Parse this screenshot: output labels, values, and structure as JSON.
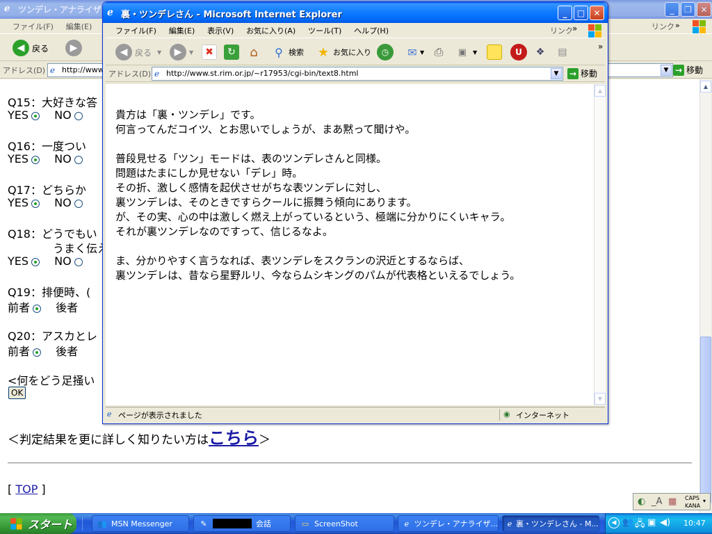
{
  "bg_window": {
    "title": "ツンデレ・アナライザー",
    "menu": [
      "ファイル(F)",
      "編集(E)",
      "表"
    ],
    "back_label": "戻る",
    "address_label": "アドレス(D)",
    "address_value": "http://www",
    "go_label": "移動",
    "links_label": "リンク",
    "questions": [
      {
        "q": "Q15：大好きな答",
        "opts": [
          "YES",
          "NO"
        ],
        "selected": 0
      },
      {
        "q": "Q16：一度つい",
        "opts": [
          "YES",
          "NO"
        ],
        "selected": 0
      },
      {
        "q": "Q17：どちらか",
        "opts": [
          "YES",
          "NO"
        ],
        "selected": 0
      },
      {
        "q": "Q18：どうでもい",
        "q2": "うまく伝え",
        "opts": [
          "YES",
          "NO"
        ],
        "selected": 0
      },
      {
        "q": "Q19：排便時、(",
        "opts": [
          "前者",
          "後者"
        ],
        "selected": 0
      },
      {
        "q": "Q20：アスカとレ",
        "opts": [
          "前者",
          "後者"
        ],
        "selected": 0
      }
    ],
    "prompt_text": "<何をどう足掻い",
    "ok_label": "OK",
    "detail_pre": "＜判定結果を更に詳しく知りたい方は",
    "detail_link": "こちら",
    "detail_post": "＞",
    "top_pre": "[ ",
    "top_link": "TOP",
    "top_post": " ]"
  },
  "fg_window": {
    "title": "裏・ツンデレさん - Microsoft Internet Explorer",
    "menu": [
      "ファイル(F)",
      "編集(E)",
      "表示(V)",
      "お気に入り(A)",
      "ツール(T)",
      "ヘルプ(H)"
    ],
    "links_label": "リンク",
    "toolbar": {
      "back": "戻る",
      "search": "検索",
      "favorites": "お気に入り"
    },
    "address_label": "アドレス(D)",
    "address_value": "http://www.st.rim.or.jp/~r17953/cgi-bin/text8.html",
    "go_label": "移動",
    "body_lines": [
      "貴方は「裏・ツンデレ」です。",
      "何言ってんだコイツ、とお思いでしょうが、まあ黙って聞けや。",
      "",
      "普段見せる「ツン」モードは、表のツンデレさんと同様。",
      "問題はたまにしか見せない「デレ」時。",
      "その折、激しく感情を起伏させがちな表ツンデレに対し、",
      "裏ツンデレは、そのときですらクールに振舞う傾向にあります。",
      "が、その実、心の中は激しく燃え上がっているという、極端に分かりにくいキャラ。",
      "それが裏ツンデレなのですって、信じるなよ。",
      "",
      "ま、分かりやすく言うなれば、表ツンデレをスクランの沢近とするならば、",
      "裏ツンデレは、昔なら星野ルリ、今ならムシキングのパムが代表格といえるでしょう。"
    ],
    "status_text": "ページが表示されました",
    "zone_text": "インターネット"
  },
  "taskbar": {
    "start_label": "スタート",
    "tasks": [
      {
        "label": "MSN Messenger",
        "icon": "messenger-icon"
      },
      {
        "label": "会話",
        "icon": "chat-icon"
      },
      {
        "label": "ScreenShot",
        "icon": "folder-icon"
      },
      {
        "label": "ツンデレ・アナライザ...",
        "icon": "ie-icon"
      },
      {
        "label": "裏・ツンデレさん - M...",
        "icon": "ie-icon",
        "active": true
      }
    ],
    "clock": "10:47"
  },
  "langbar": {
    "caps": "CAPS",
    "kana": "KANA"
  }
}
